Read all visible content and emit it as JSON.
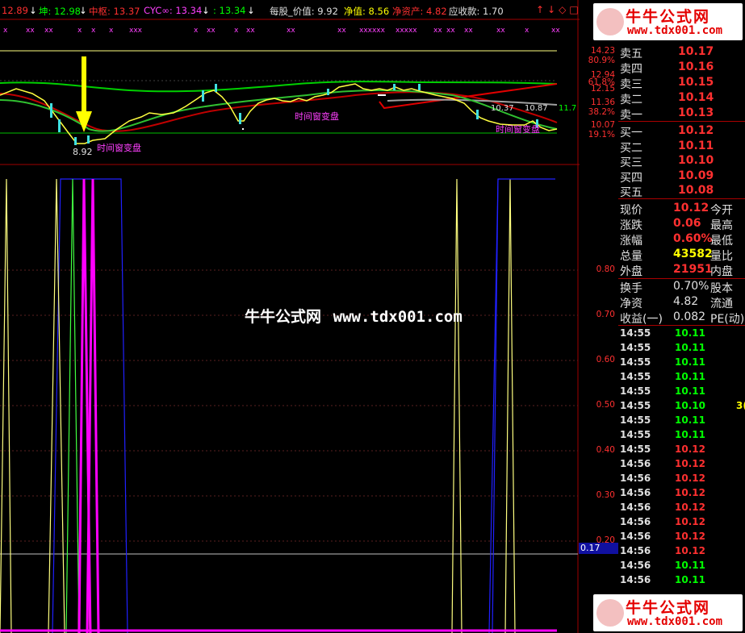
{
  "header": {
    "items": [
      {
        "label": "12.89",
        "color": "#ff3030"
      },
      {
        "label": "↓",
        "color": "#ffffff"
      },
      {
        "label": "坤: 12.98",
        "color": "#00ff00"
      },
      {
        "label": "↓",
        "color": "#ffffff"
      },
      {
        "label": "中枢: 13.37",
        "color": "#ff3030"
      },
      {
        "label": "CYC∞: 13.34",
        "color": "#ff40ff"
      },
      {
        "label": "↓",
        "color": "#ffffff"
      },
      {
        "label": ": 13.34",
        "color": "#00ff00"
      },
      {
        "label": "↓",
        "color": "#ffffff"
      },
      {
        "label": "每股_价值: 9.92",
        "color": "#e0e0e0"
      },
      {
        "label": "净值: 8.56",
        "color": "#ffff00"
      },
      {
        "label": "净资产: 4.82",
        "color": "#ff3030"
      },
      {
        "label": "应收款: 1.70",
        "color": "#e0e0e0"
      }
    ],
    "right_icons": [
      "↑",
      "↓",
      "◇",
      "□"
    ]
  },
  "price_axis": {
    "labels": [
      {
        "text": "14.23",
        "color": "#ff3030"
      },
      {
        "text": "80.9%",
        "color": "#ff3030"
      },
      {
        "text": "12.94",
        "color": "#ff3030"
      },
      {
        "text": "61.8%",
        "color": "#ff3030"
      },
      {
        "text": "12.15",
        "color": "#ff3030"
      },
      {
        "text": "11.36",
        "color": "#ff3030"
      },
      {
        "text": "38.2%",
        "color": "#ff3030"
      },
      {
        "text": "10.07",
        "color": "#ff3030"
      },
      {
        "text": "19.1%",
        "color": "#ff3030"
      }
    ]
  },
  "indicator_axis": {
    "labels": [
      "0.80",
      "0.70",
      "0.60",
      "0.50",
      "0.40",
      "0.30",
      "0.20"
    ],
    "current": "0.17"
  },
  "annotations": {
    "low_price": "8.92",
    "time_window_1": "时间窗变盘",
    "time_window_2": "时间窗变盘",
    "time_window_3": "时间窗变盘",
    "level_a": "10.37",
    "level_b": "10.87",
    "level_c": "11.7"
  },
  "watermark": {
    "name": "牛牛公式网",
    "url": "www.tdx001.com"
  },
  "logo": {
    "name": "牛牛公式网",
    "url": "www.tdx001.com"
  },
  "quote": {
    "sell": [
      {
        "label": "卖五",
        "price": "10.17"
      },
      {
        "label": "卖四",
        "price": "10.16"
      },
      {
        "label": "卖三",
        "price": "10.15"
      },
      {
        "label": "卖二",
        "price": "10.14"
      },
      {
        "label": "卖一",
        "price": "10.13"
      }
    ],
    "buy": [
      {
        "label": "买一",
        "price": "10.12"
      },
      {
        "label": "买二",
        "price": "10.11"
      },
      {
        "label": "买三",
        "price": "10.10"
      },
      {
        "label": "买四",
        "price": "10.09"
      },
      {
        "label": "买五",
        "price": "10.08"
      }
    ],
    "stats": [
      {
        "k": "现价",
        "v": "10.12",
        "vcolor": "#ff3030",
        "k2": "今开"
      },
      {
        "k": "涨跌",
        "v": "0.06",
        "vcolor": "#ff3030",
        "k2": "最高"
      },
      {
        "k": "涨幅",
        "v": "0.60%",
        "vcolor": "#ff3030",
        "k2": "最低"
      },
      {
        "k": "总量",
        "v": "43582",
        "vcolor": "#ffff00",
        "k2": "量比"
      },
      {
        "k": "外盘",
        "v": "21951",
        "vcolor": "#ff3030",
        "k2": "内盘"
      }
    ],
    "stats2": [
      {
        "k": "换手",
        "v": "0.70%",
        "vcolor": "#e0e0e0",
        "k2": "股本"
      },
      {
        "k": "净资",
        "v": "4.82",
        "vcolor": "#e0e0e0",
        "k2": "流通"
      },
      {
        "k": "收益(一)",
        "v": "0.082",
        "vcolor": "#e0e0e0",
        "k2": "PE(动)"
      }
    ]
  },
  "ticks": [
    {
      "time": "14:55",
      "price": "10.11",
      "color": "#00ff00",
      "vol": ""
    },
    {
      "time": "14:55",
      "price": "10.11",
      "color": "#00ff00",
      "vol": ""
    },
    {
      "time": "14:55",
      "price": "10.11",
      "color": "#00ff00",
      "vol": ""
    },
    {
      "time": "14:55",
      "price": "10.11",
      "color": "#00ff00",
      "vol": ""
    },
    {
      "time": "14:55",
      "price": "10.11",
      "color": "#00ff00",
      "vol": ""
    },
    {
      "time": "14:55",
      "price": "10.10",
      "color": "#00ff00",
      "vol": "3("
    },
    {
      "time": "14:55",
      "price": "10.11",
      "color": "#00ff00",
      "vol": ""
    },
    {
      "time": "14:55",
      "price": "10.11",
      "color": "#00ff00",
      "vol": ""
    },
    {
      "time": "14:55",
      "price": "10.12",
      "color": "#ff3030",
      "vol": ""
    },
    {
      "time": "14:56",
      "price": "10.12",
      "color": "#ff3030",
      "vol": ""
    },
    {
      "time": "14:56",
      "price": "10.12",
      "color": "#ff3030",
      "vol": ""
    },
    {
      "time": "14:56",
      "price": "10.12",
      "color": "#ff3030",
      "vol": ""
    },
    {
      "time": "14:56",
      "price": "10.12",
      "color": "#ff3030",
      "vol": ""
    },
    {
      "time": "14:56",
      "price": "10.12",
      "color": "#ff3030",
      "vol": ""
    },
    {
      "time": "14:56",
      "price": "10.12",
      "color": "#ff3030",
      "vol": ""
    },
    {
      "time": "14:56",
      "price": "10.12",
      "color": "#ff3030",
      "vol": ""
    },
    {
      "time": "14:56",
      "price": "10.11",
      "color": "#00ff00",
      "vol": ""
    },
    {
      "time": "14:56",
      "price": "10.11",
      "color": "#00ff00",
      "vol": ""
    }
  ]
}
